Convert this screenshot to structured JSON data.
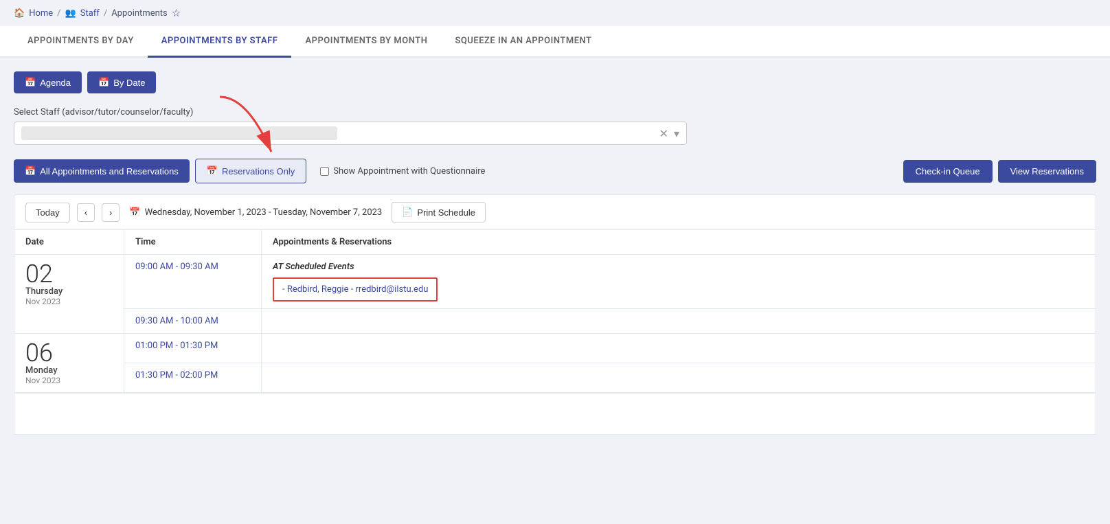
{
  "breadcrumb": {
    "home_label": "Home",
    "staff_label": "Staff",
    "page_label": "Appointments"
  },
  "tabs": [
    {
      "id": "by-day",
      "label": "APPOINTMENTS BY DAY",
      "active": false
    },
    {
      "id": "by-staff",
      "label": "APPOINTMENTS BY STAFF",
      "active": true
    },
    {
      "id": "by-month",
      "label": "APPOINTMENTS BY MONTH",
      "active": false
    },
    {
      "id": "squeeze",
      "label": "SQUEEZE IN AN APPOINTMENT",
      "active": false
    }
  ],
  "view_buttons": {
    "agenda_label": "Agenda",
    "by_date_label": "By Date"
  },
  "staff_select": {
    "label": "Select Staff (advisor/tutor/counselor/faculty)",
    "placeholder": ""
  },
  "filter_buttons": {
    "all_appts_label": "All Appointments and Reservations",
    "reservations_only_label": "Reservations Only",
    "questionnaire_label": "Show Appointment with Questionnaire",
    "checkin_label": "Check-in Queue",
    "view_reservations_label": "View Reservations"
  },
  "calendar": {
    "today_label": "Today",
    "date_range": "Wednesday, November 1, 2023 - Tuesday, November 7, 2023",
    "print_label": "Print Schedule"
  },
  "table": {
    "col_date": "Date",
    "col_time": "Time",
    "col_appts": "Appointments & Reservations"
  },
  "rows": [
    {
      "date_number": "02",
      "date_day": "Thursday",
      "date_month": "Nov 2023",
      "times": [
        {
          "time": "09:00 AM - 09:30 AM",
          "has_event": true,
          "event_title": "AT Scheduled Events",
          "event_item": "- Redbird, Reggie - rredbird@ilstu.edu"
        },
        {
          "time": "09:30 AM - 10:00 AM",
          "has_event": false,
          "event_title": "",
          "event_item": ""
        }
      ]
    },
    {
      "date_number": "06",
      "date_day": "Monday",
      "date_month": "Nov 2023",
      "times": [
        {
          "time": "01:00 PM - 01:30 PM",
          "has_event": false,
          "event_title": "",
          "event_item": ""
        },
        {
          "time": "01:30 PM - 02:00 PM",
          "has_event": false,
          "event_title": "",
          "event_item": ""
        }
      ]
    }
  ]
}
